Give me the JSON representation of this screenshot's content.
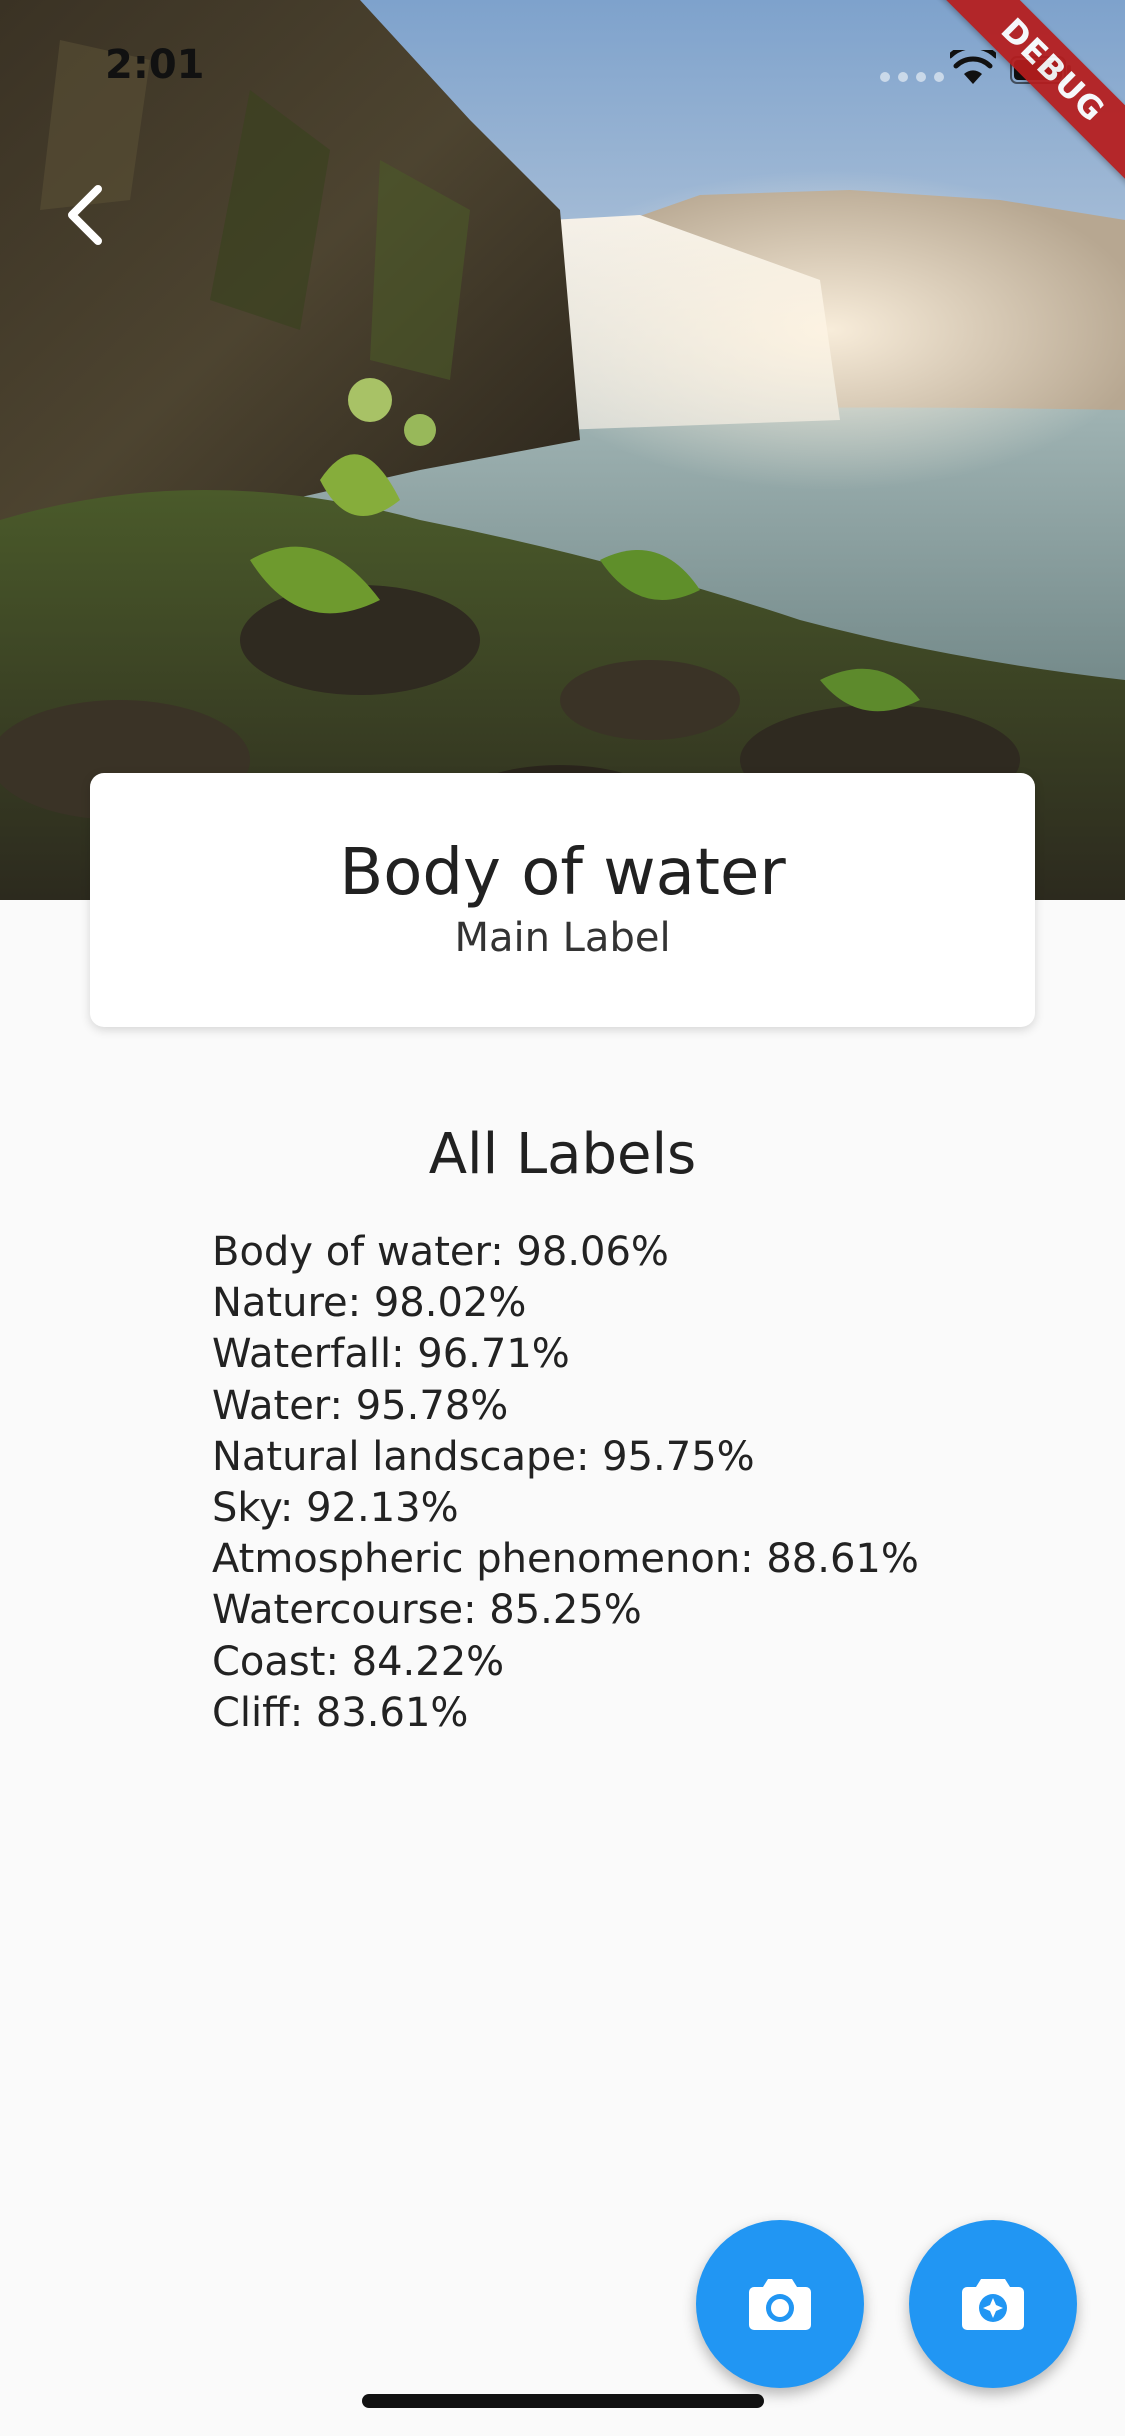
{
  "status_bar": {
    "time": "2:01"
  },
  "debug_banner": "DEBUG",
  "main_label": {
    "title": "Body of water",
    "subtitle": "Main Label"
  },
  "all_labels": {
    "heading": "All Labels",
    "items": [
      "Body of water: 98.06%",
      "Nature: 98.02%",
      "Waterfall: 96.71%",
      "Water: 95.78%",
      "Natural landscape: 95.75%",
      "Sky: 92.13%",
      "Atmospheric phenomenon: 88.61%",
      "Watercourse: 85.25%",
      "Coast: 84.22%",
      "Cliff: 83.61%"
    ]
  },
  "icons": {
    "back": "chevron-left-icon",
    "camera": "camera-icon",
    "gallery": "camera-enhance-icon"
  },
  "colors": {
    "fab": "#2196f3",
    "ribbon": "#b71c1c",
    "background": "#fafafa"
  }
}
